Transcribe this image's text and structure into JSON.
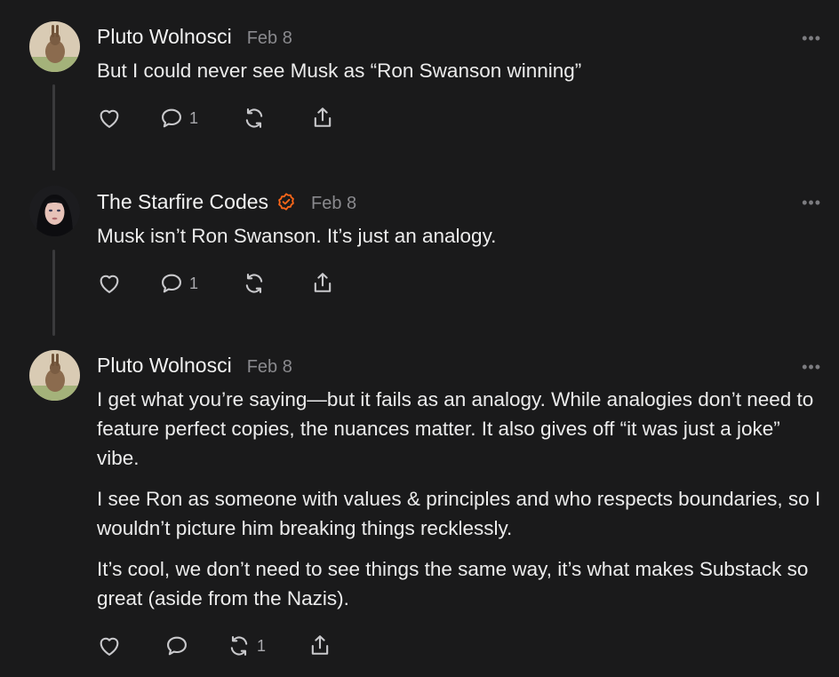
{
  "comments": [
    {
      "author": "Pluto Wolnosci",
      "date": "Feb 8",
      "verified": false,
      "more": "•••",
      "paragraphs": [
        "But I could never see Musk as “Ron Swanson winning”"
      ],
      "like_count": "",
      "reply_count": "1",
      "restack_count": ""
    },
    {
      "author": "The Starfire Codes",
      "date": "Feb 8",
      "verified": true,
      "more": "•••",
      "paragraphs": [
        "Musk isn’t Ron Swanson. It’s just an analogy."
      ],
      "like_count": "",
      "reply_count": "1",
      "restack_count": ""
    },
    {
      "author": "Pluto Wolnosci",
      "date": "Feb 8",
      "verified": false,
      "more": "•••",
      "paragraphs": [
        "I get what you’re saying—but it fails as an analogy. While analogies don’t need to feature perfect copies, the nuances matter. It also gives off “it was just a joke” vibe.",
        "I see Ron as someone with values & principles and who respects boundaries, so I wouldn’t picture him breaking things recklessly.",
        "It’s cool, we don’t need to see things the same way, it’s what makes Substack so great (aside from the Nazis)."
      ],
      "like_count": "",
      "reply_count": "",
      "restack_count": "1"
    }
  ],
  "icons": {
    "like": "heart-icon",
    "reply": "comment-bubble-icon",
    "restack": "restack-icon",
    "share": "share-icon",
    "verified": "verified-check-icon",
    "more": "more-dots-icon"
  },
  "colors": {
    "background": "#1a1a1b",
    "verified_badge": "#ff6719",
    "muted_text": "#8a8a8e"
  }
}
